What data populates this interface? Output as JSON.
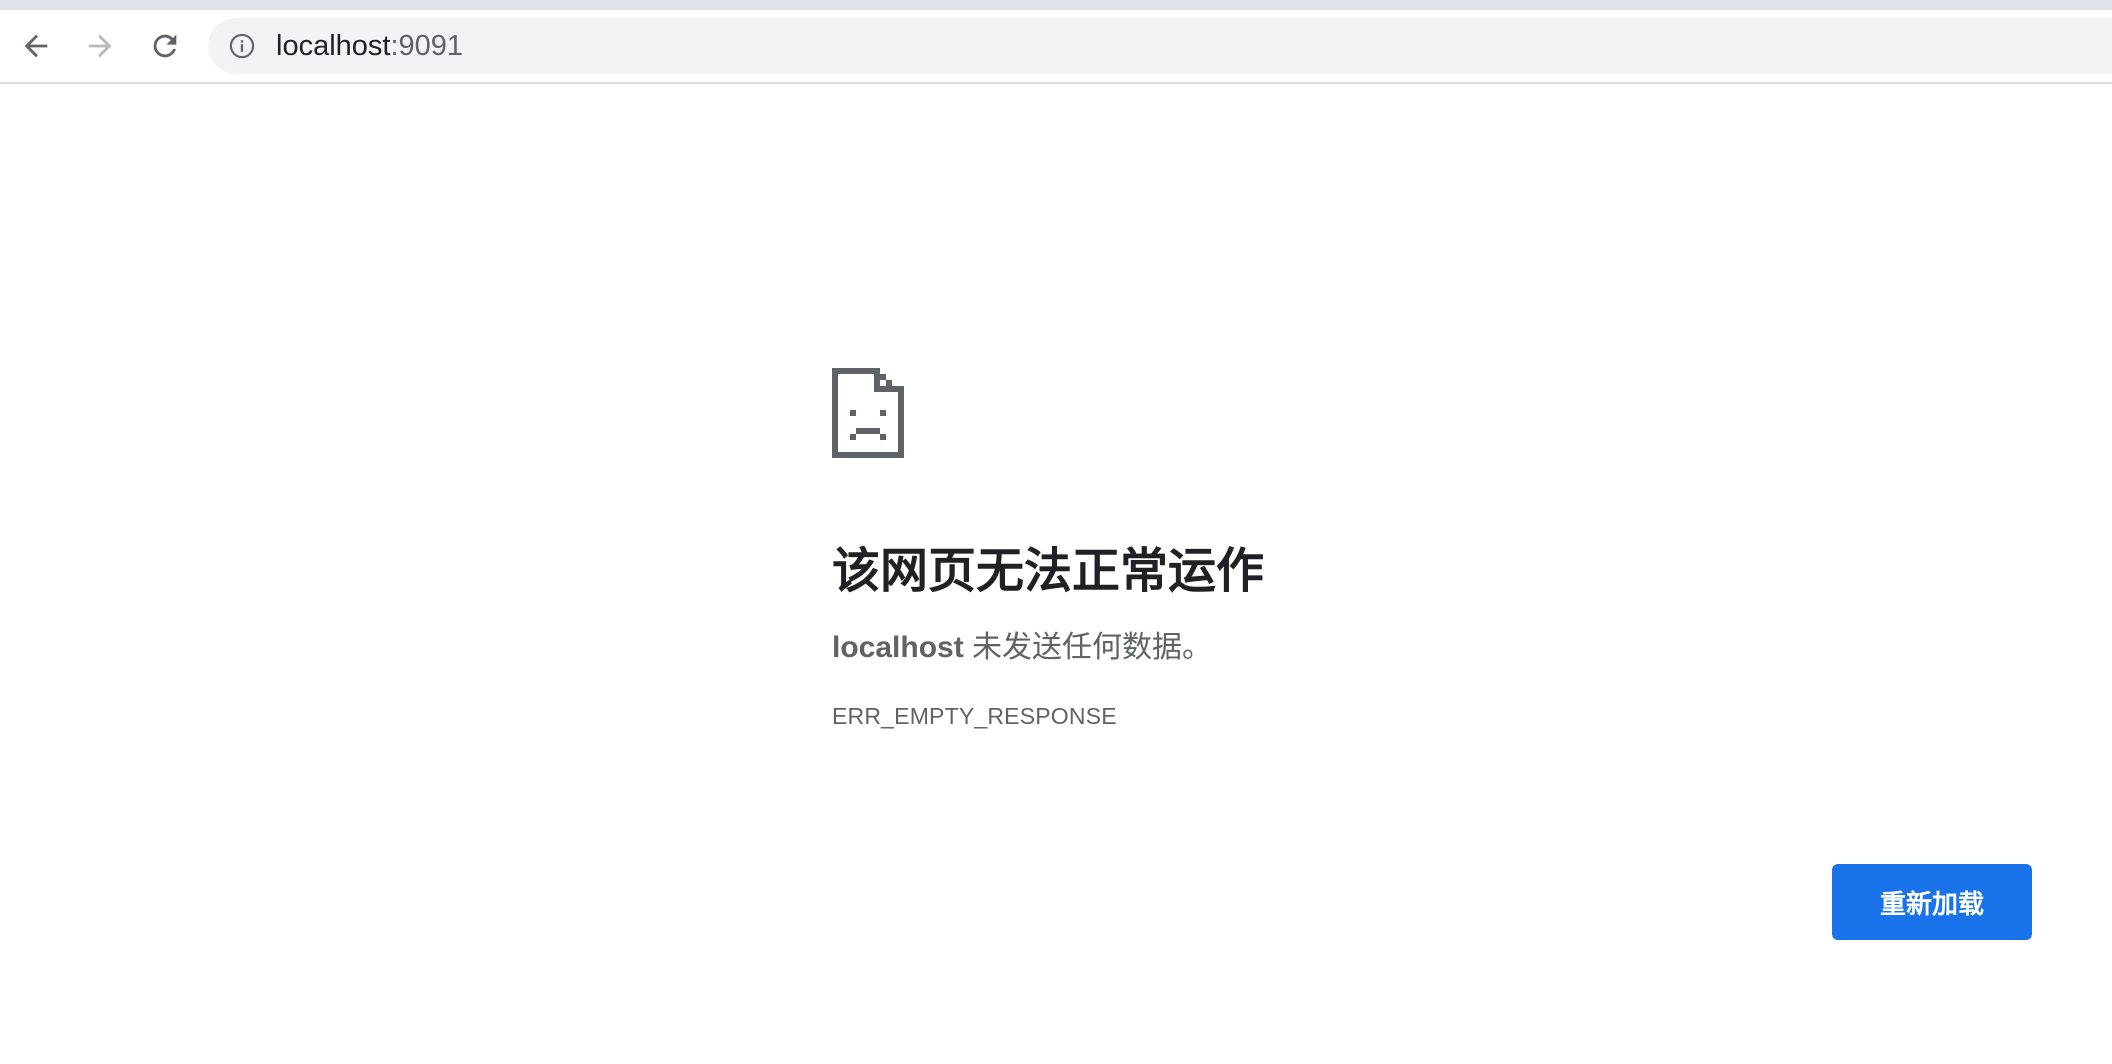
{
  "browser": {
    "address_bar": {
      "host": "localhost",
      "port": ":9091"
    },
    "icons": {
      "back": "arrow-left-icon",
      "forward": "arrow-right-icon",
      "reload": "reload-icon",
      "site_info": "info-icon"
    }
  },
  "error_page": {
    "icon": "sad-page-icon",
    "title": "该网页无法正常运作",
    "description_host": "localhost",
    "description_rest": " 未发送任何数据。",
    "error_code": "ERR_EMPTY_RESPONSE",
    "reload_button_label": "重新加载"
  },
  "colors": {
    "primary_button": "#1a73e8",
    "text_primary": "#202124",
    "text_secondary": "#5f6368",
    "omnibox_bg": "#f1f3f4"
  }
}
